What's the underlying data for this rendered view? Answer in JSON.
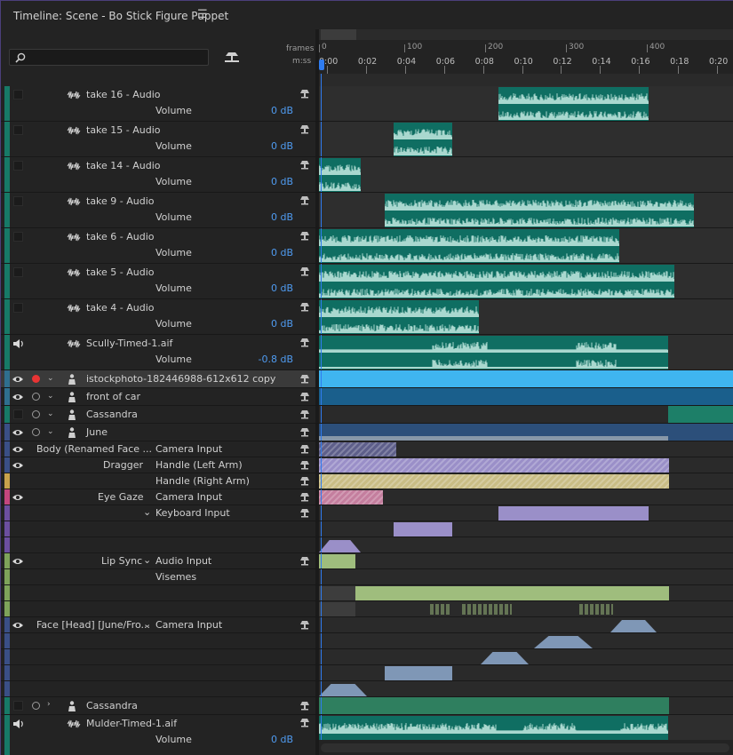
{
  "window": {
    "title": "Timeline: Scene - Bo Stick Figure Puppet",
    "menu_icon": "hamburger-menu-icon"
  },
  "header": {
    "search_placeholder": "",
    "frames_label": "frames",
    "time_label": "m:ss"
  },
  "ruler": {
    "frame_labels": [
      "0",
      "100",
      "200",
      "300",
      "400"
    ],
    "time_labels": [
      "0:00",
      "0:02",
      "0:04",
      "0:06",
      "0:08",
      "0:10",
      "0:12",
      "0:14",
      "0:16",
      "0:18",
      "0:20"
    ]
  },
  "audio_tracks": [
    {
      "name": "take 16 - Audio",
      "param": "Volume",
      "value": "0 dB"
    },
    {
      "name": "take 15 - Audio",
      "param": "Volume",
      "value": "0 dB"
    },
    {
      "name": "take 14 - Audio",
      "param": "Volume",
      "value": "0 dB"
    },
    {
      "name": "take 9 - Audio",
      "param": "Volume",
      "value": "0 dB"
    },
    {
      "name": "take 6 - Audio",
      "param": "Volume",
      "value": "0 dB"
    },
    {
      "name": "take 5 - Audio",
      "param": "Volume",
      "value": "0 dB"
    },
    {
      "name": "take 4 - Audio",
      "param": "Volume",
      "value": "0 dB"
    },
    {
      "name": "Scully-Timed-1.aif",
      "param": "Volume",
      "value": "-0.8 dB"
    }
  ],
  "puppet_tracks": [
    {
      "name": "istockphoto-182446988-612x612 copy"
    },
    {
      "name": "front of car"
    },
    {
      "name": "Cassandra"
    },
    {
      "name": "June"
    }
  ],
  "behaviors": {
    "body": "Body (Renamed Face ...",
    "camera_input": "Camera Input",
    "dragger": "Dragger",
    "handle_left": "Handle (Left Arm)",
    "handle_right": "Handle (Right Arm)",
    "eye_gaze": "Eye Gaze",
    "eye_camera": "Camera Input",
    "keyboard_input": "Keyboard Input",
    "lip_sync": "Lip Sync",
    "audio_input": "Audio Input",
    "visemes": "Visemes",
    "face": "Face [Head] [June/Fro...",
    "face_camera": "Camera Input"
  },
  "bottom_tracks": {
    "cassandra": "Cassandra",
    "mulder": "Mulder-Timed-1.aif",
    "mulder_param": "Volume",
    "mulder_value": "0 dB"
  },
  "colors": {
    "audio_clip": "#0f6e62",
    "waveform": "#a9d8cf",
    "selected_track": "#3fb5f0",
    "front_of_car": "#1a5f8c",
    "cassandra": "#1d7f68",
    "june": "#2c4f7a",
    "dragger": "#9a8fc8",
    "handle_right": "#c9bd85",
    "eye_gaze": "#c47e9e",
    "keyboard": "#9a8fc8",
    "lip_sync": "#9fbd7d",
    "face_camera": "#7f97b6",
    "playhead": "#2f7cf0"
  }
}
